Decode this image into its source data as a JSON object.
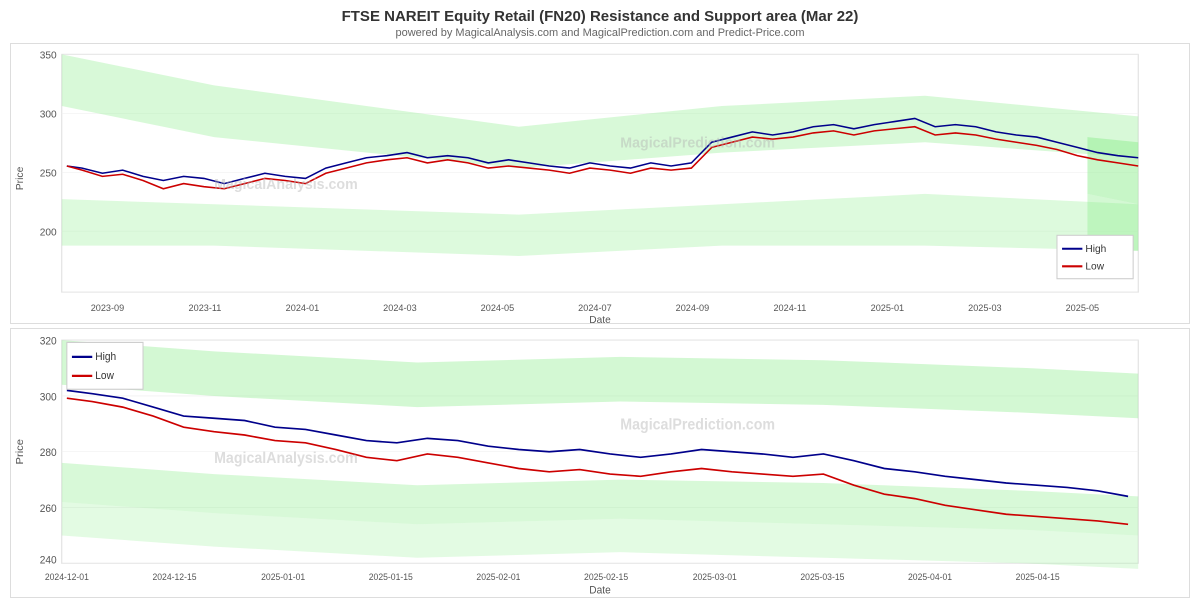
{
  "page": {
    "title": "FTSE NAREIT Equity Retail (FN20) Resistance and Support area (Mar 22)",
    "subtitle": "powered by MagicalAnalysis.com and MagicalPrediction.com and Predict-Price.com"
  },
  "chart1": {
    "y_label": "Price",
    "x_label": "Date",
    "y_ticks": [
      "350",
      "300",
      "250",
      "200"
    ],
    "x_ticks": [
      "2023-09",
      "2023-11",
      "2024-01",
      "2024-03",
      "2024-05",
      "2024-07",
      "2024-09",
      "2024-11",
      "2025-01",
      "2025-03",
      "2025-05"
    ],
    "legend": {
      "high_label": "High",
      "low_label": "Low"
    },
    "watermark": "MagicalAnalysis.com    MagicalPrediction.com"
  },
  "chart2": {
    "y_label": "Price",
    "x_label": "Date",
    "y_ticks": [
      "320",
      "300",
      "280",
      "260",
      "240"
    ],
    "x_ticks": [
      "2024-12-01",
      "2024-12-15",
      "2025-01-01",
      "2025-01-15",
      "2025-02-01",
      "2025-02-15",
      "2025-03-01",
      "2025-03-15",
      "2025-04-01",
      "2025-04-15"
    ],
    "legend": {
      "high_label": "High",
      "low_label": "Low"
    },
    "watermark": "MagicalAnalysis.com    MagicalPrediction.com"
  }
}
